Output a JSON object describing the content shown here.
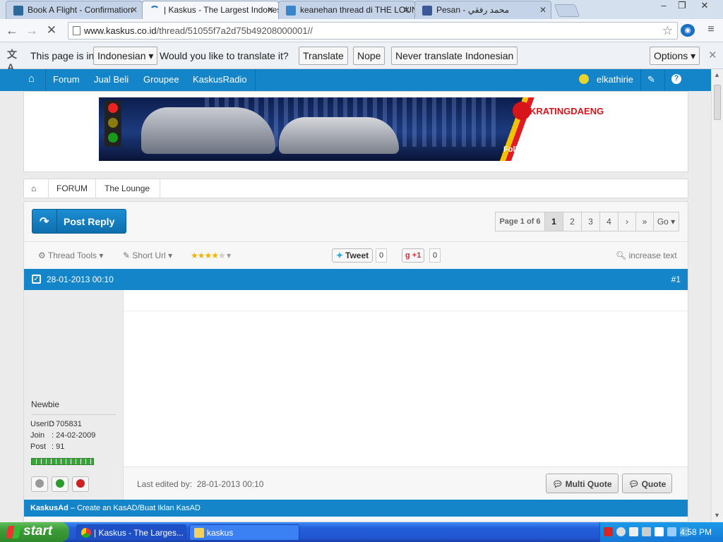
{
  "browser": {
    "tabs": [
      {
        "title": "Book A Flight - Confirmation",
        "favicon_color": "#2b6a9a",
        "active": false
      },
      {
        "title": "| Kaskus - The Largest Indonesian",
        "favicon_color": "#1e73c9",
        "active": true
      },
      {
        "title": "keanehan thread di THE LOUNGE",
        "favicon_color": "#3a85c8",
        "active": false
      },
      {
        "title": "Pesan - محمد رفقي",
        "favicon_color": "#3b5998",
        "active": false
      }
    ],
    "url_host": "www.kaskus.co.id",
    "url_path": "/thread/51055f7a2d75b49208000001//"
  },
  "translate_bar": {
    "prefix": "This page is in",
    "language": "Indonesian",
    "question": "Would you like to translate it?",
    "translate_label": "Translate",
    "nope_label": "Nope",
    "never_label": "Never translate Indonesian",
    "options_label": "Options"
  },
  "kaskus_nav": {
    "items": [
      "Forum",
      "Jual Beli",
      "Groupee",
      "KaskusRadio"
    ],
    "username": "elkathirie"
  },
  "banner": {
    "brand": "KRATINGDAENG",
    "follow_text": "Follow us @MyKratingdaeng"
  },
  "breadcrumb": {
    "items": [
      "FORUM",
      "The Lounge"
    ]
  },
  "thread": {
    "post_reply_label": "Post Reply",
    "pager": {
      "label": "Page 1 of 6",
      "pages": [
        "1",
        "2",
        "3",
        "4"
      ],
      "current": "1",
      "go_label": "Go"
    },
    "tools": {
      "thread_tools": "Thread Tools",
      "short_url": "Short Url",
      "tweet_label": "Tweet",
      "tweet_count": "0",
      "gplus_label": "+1",
      "gplus_count": "0",
      "increase_text": "increase text",
      "rating_stars": 4
    },
    "post": {
      "datetime": "28-01-2013 00:10",
      "number": "#1",
      "user_rank": "Newbie",
      "user_id_label": "UserID",
      "user_id": ": 705831",
      "join_label": "Join",
      "join_date": ": 24-02-2009",
      "post_label": "Post",
      "post_count": ": 91",
      "edited_label": "Last edited by:",
      "edited_date": "28-01-2013 00:10",
      "multi_quote_label": "Multi Quote",
      "quote_label": "Quote"
    },
    "kasad": {
      "brand": "KaskusAd",
      "text": " – Create an KasAD/Buat Iklan KasAD"
    }
  },
  "taskbar": {
    "start_label": "start",
    "tasks": [
      "| Kaskus - The Larges...",
      "kaskus"
    ],
    "clock": "4:58 PM"
  },
  "colors": {
    "kaskus_blue": "#1485c9",
    "taskbar_blue": "#245edb",
    "start_green": "#3c9a37"
  }
}
